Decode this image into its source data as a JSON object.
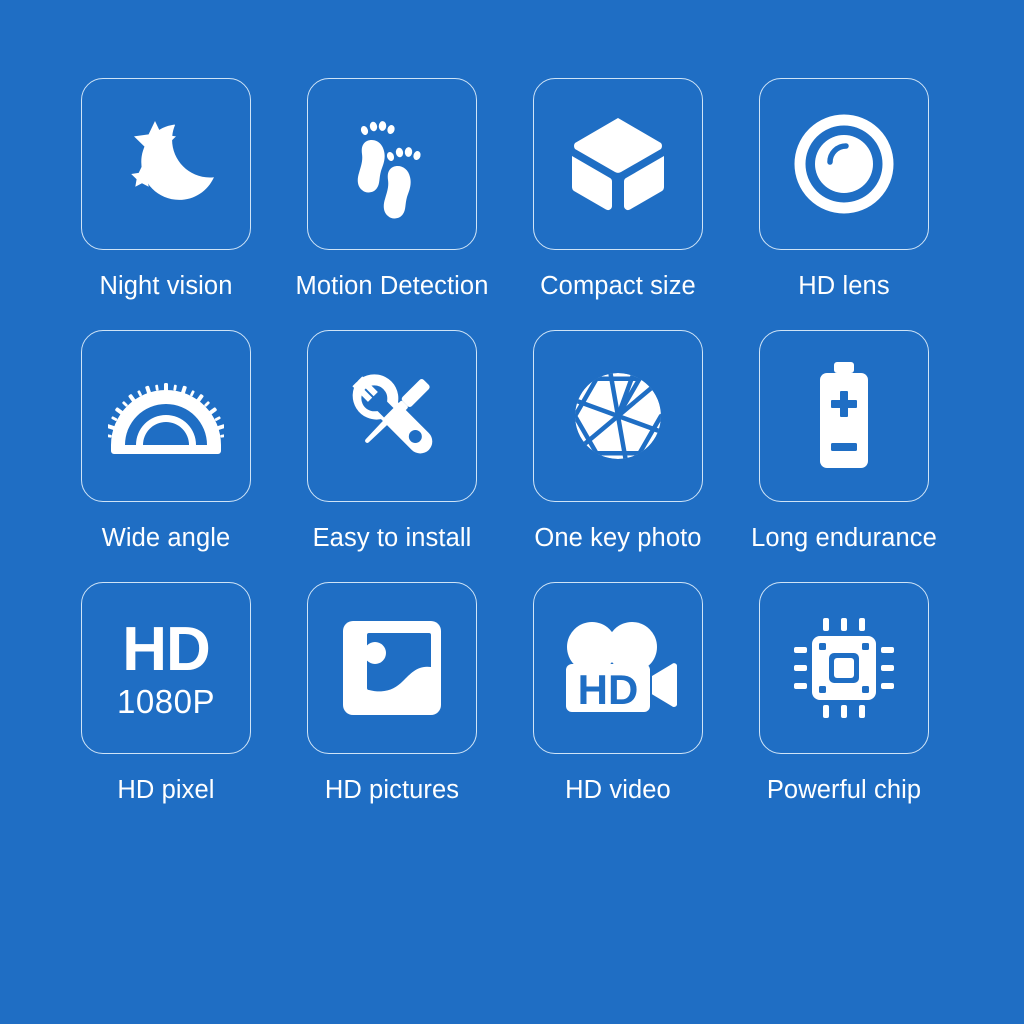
{
  "page": {
    "background_color": "#1f6ec4",
    "foreground_color": "#ffffff",
    "tile_border_color": "#cfe4f7",
    "columns": 4,
    "rows": 3
  },
  "features": [
    {
      "id": "night-vision",
      "label": "Night vision",
      "icon": "moon-stars-icon"
    },
    {
      "id": "motion-detection",
      "label": "Motion Detection",
      "icon": "footprints-icon"
    },
    {
      "id": "compact-size",
      "label": "Compact size",
      "icon": "cube-icon"
    },
    {
      "id": "hd-lens",
      "label": "HD lens",
      "icon": "camera-lens-icon"
    },
    {
      "id": "wide-angle",
      "label": "Wide angle",
      "icon": "protractor-icon"
    },
    {
      "id": "easy-to-install",
      "label": "Easy to install",
      "icon": "wrench-screwdriver-icon"
    },
    {
      "id": "one-key-photo",
      "label": "One key photo",
      "icon": "aperture-icon"
    },
    {
      "id": "long-endurance",
      "label": "Long endurance",
      "icon": "battery-icon"
    },
    {
      "id": "hd-pixel",
      "label": "HD pixel",
      "icon": "hd-1080p-text-icon",
      "icon_text_primary": "HD",
      "icon_text_secondary": "1080P"
    },
    {
      "id": "hd-pictures",
      "label": "HD pictures",
      "icon": "photo-icon"
    },
    {
      "id": "hd-video",
      "label": "HD video",
      "icon": "hd-video-camera-icon",
      "icon_text_primary": "HD"
    },
    {
      "id": "powerful-chip",
      "label": "Powerful chip",
      "icon": "cpu-chip-icon"
    }
  ]
}
